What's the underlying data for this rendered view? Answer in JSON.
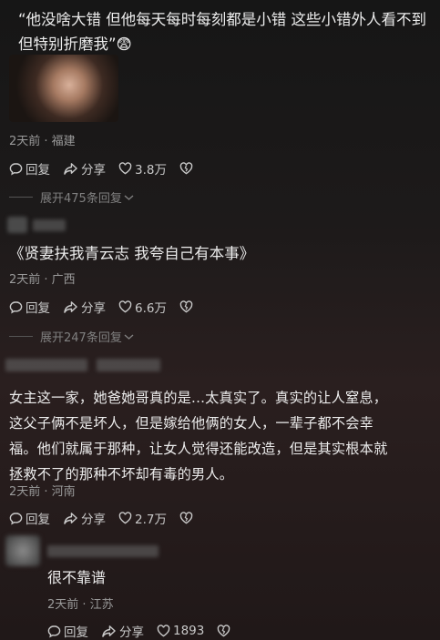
{
  "comment1": {
    "text": "“他没啥大错 但他每天每时每刻都是小错 这些小错外人看不到 但特别折磨我”😨",
    "meta": "2天前 · 福建",
    "reply": "回复",
    "share": "分享",
    "likes": "3.8万",
    "expand": "展开475条回复"
  },
  "comment2": {
    "text": "《贤妻扶我青云志 我夸自己有本事》",
    "meta": "2天前 · 广西",
    "reply": "回复",
    "share": "分享",
    "likes": "6.6万",
    "expand": "展开247条回复"
  },
  "comment3": {
    "line1": "女主这一家，她爸她哥真的是...太真实了。真实的让人窒息，",
    "line2": "这父子俩不是坏人，但是嫁给他俩的女人，一辈子都不会幸",
    "line3": "福。他们就属于那种，让女人觉得还能改造，但是其实根本就",
    "line4": "拯救不了的那种不坏却有毒的男人。",
    "meta": "2天前 · 河南",
    "reply": "回复",
    "share": "分享",
    "likes": "2.7万"
  },
  "reply1": {
    "text": "很不靠谱",
    "meta": "2天前 · 江苏",
    "reply": "回复",
    "share": "分享",
    "likes": "1893"
  },
  "icons": {
    "reply": "comment-bubble-icon",
    "share": "share-arrow-icon",
    "like": "heart-icon",
    "dislike": "broken-heart-icon",
    "expand": "chevron-down-icon"
  }
}
